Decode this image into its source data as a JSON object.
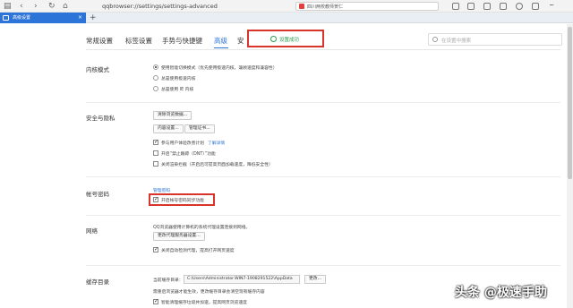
{
  "browser": {
    "tab_title": "高级设置",
    "new_tab": "+",
    "url": "qqbrowser://settings/settings-advanced",
    "search_text": "四川两校教师贺仁",
    "nav_back": "‹",
    "nav_forward": "›",
    "nav_reload": "↻",
    "nav_home": "⌂"
  },
  "settings_nav": {
    "tabs": [
      "常规设置",
      "标签设置",
      "手势与快捷键",
      "高级",
      "安"
    ],
    "active_tab": "高级",
    "search_placeholder": "在设置中搜索"
  },
  "toast": {
    "text": "设置成功",
    "color": "#2a9d4a"
  },
  "sections": {
    "kernel": {
      "title": "内核模式",
      "options": [
        "使用智能切换模式（优先使用极速内核，兼顾速度和兼容性）",
        "总是使用极速内核",
        "总是使用 IE 内核"
      ],
      "selected_index": 0
    },
    "privacy": {
      "title": "安全与隐私",
      "clear_button": "清除浏览数据...",
      "content_button": "内容设置...",
      "cert_button": "管理证书...",
      "ux_checkbox": "参与用户体验改善计划",
      "ux_link": "了解详情",
      "dnt_checkbox": "开启“禁止跟踪（DNT）”功能",
      "block_checkbox": "关闭渲染拦截（开启后可提高页面加载速度，降低安全性）"
    },
    "password": {
      "title": "帐号密码",
      "manage_link": "管理密码",
      "sync_checkbox": "开启帐号密码同步功能"
    },
    "network": {
      "title": "网络",
      "description": "QQ浏览器使用计算机的系统代理设置连接到网络。",
      "proxy_button": "更改代理服务器设置...",
      "dns_checkbox": "关闭自动检测代理，提高打开网页速度"
    },
    "cache": {
      "title": "缓存目录",
      "current_label": "当前缓存目录：",
      "path": "C:\\Users\\Administrator.WIN7-1908291522\\AppData",
      "change_button": "更改...",
      "note": "需重启浏览器才能生效，更改缓存目录会清空现有缓存内容",
      "smart_checkbox": "智能清理缓存垃圾并加速，提高网页浏览速度"
    }
  },
  "watermark": "头条 @极速手助",
  "colors": {
    "accent": "#2d74d8",
    "highlight": "#d9342b"
  }
}
